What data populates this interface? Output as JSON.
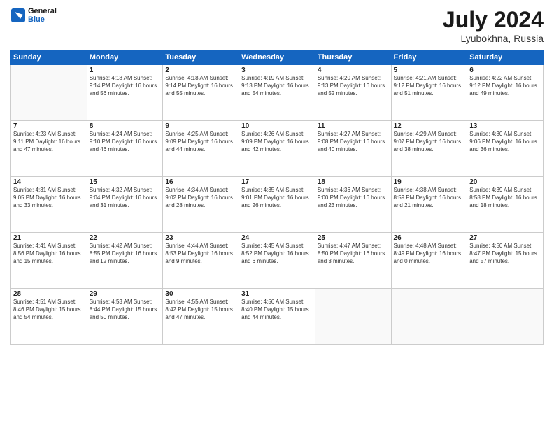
{
  "header": {
    "logo_line1": "General",
    "logo_line2": "Blue",
    "month": "July 2024",
    "location": "Lyubokhna, Russia"
  },
  "columns": [
    "Sunday",
    "Monday",
    "Tuesday",
    "Wednesday",
    "Thursday",
    "Friday",
    "Saturday"
  ],
  "weeks": [
    [
      {
        "day": "",
        "info": ""
      },
      {
        "day": "1",
        "info": "Sunrise: 4:18 AM\nSunset: 9:14 PM\nDaylight: 16 hours\nand 56 minutes."
      },
      {
        "day": "2",
        "info": "Sunrise: 4:18 AM\nSunset: 9:14 PM\nDaylight: 16 hours\nand 55 minutes."
      },
      {
        "day": "3",
        "info": "Sunrise: 4:19 AM\nSunset: 9:13 PM\nDaylight: 16 hours\nand 54 minutes."
      },
      {
        "day": "4",
        "info": "Sunrise: 4:20 AM\nSunset: 9:13 PM\nDaylight: 16 hours\nand 52 minutes."
      },
      {
        "day": "5",
        "info": "Sunrise: 4:21 AM\nSunset: 9:12 PM\nDaylight: 16 hours\nand 51 minutes."
      },
      {
        "day": "6",
        "info": "Sunrise: 4:22 AM\nSunset: 9:12 PM\nDaylight: 16 hours\nand 49 minutes."
      }
    ],
    [
      {
        "day": "7",
        "info": "Sunrise: 4:23 AM\nSunset: 9:11 PM\nDaylight: 16 hours\nand 47 minutes."
      },
      {
        "day": "8",
        "info": "Sunrise: 4:24 AM\nSunset: 9:10 PM\nDaylight: 16 hours\nand 46 minutes."
      },
      {
        "day": "9",
        "info": "Sunrise: 4:25 AM\nSunset: 9:09 PM\nDaylight: 16 hours\nand 44 minutes."
      },
      {
        "day": "10",
        "info": "Sunrise: 4:26 AM\nSunset: 9:09 PM\nDaylight: 16 hours\nand 42 minutes."
      },
      {
        "day": "11",
        "info": "Sunrise: 4:27 AM\nSunset: 9:08 PM\nDaylight: 16 hours\nand 40 minutes."
      },
      {
        "day": "12",
        "info": "Sunrise: 4:29 AM\nSunset: 9:07 PM\nDaylight: 16 hours\nand 38 minutes."
      },
      {
        "day": "13",
        "info": "Sunrise: 4:30 AM\nSunset: 9:06 PM\nDaylight: 16 hours\nand 36 minutes."
      }
    ],
    [
      {
        "day": "14",
        "info": "Sunrise: 4:31 AM\nSunset: 9:05 PM\nDaylight: 16 hours\nand 33 minutes."
      },
      {
        "day": "15",
        "info": "Sunrise: 4:32 AM\nSunset: 9:04 PM\nDaylight: 16 hours\nand 31 minutes."
      },
      {
        "day": "16",
        "info": "Sunrise: 4:34 AM\nSunset: 9:02 PM\nDaylight: 16 hours\nand 28 minutes."
      },
      {
        "day": "17",
        "info": "Sunrise: 4:35 AM\nSunset: 9:01 PM\nDaylight: 16 hours\nand 26 minutes."
      },
      {
        "day": "18",
        "info": "Sunrise: 4:36 AM\nSunset: 9:00 PM\nDaylight: 16 hours\nand 23 minutes."
      },
      {
        "day": "19",
        "info": "Sunrise: 4:38 AM\nSunset: 8:59 PM\nDaylight: 16 hours\nand 21 minutes."
      },
      {
        "day": "20",
        "info": "Sunrise: 4:39 AM\nSunset: 8:58 PM\nDaylight: 16 hours\nand 18 minutes."
      }
    ],
    [
      {
        "day": "21",
        "info": "Sunrise: 4:41 AM\nSunset: 8:56 PM\nDaylight: 16 hours\nand 15 minutes."
      },
      {
        "day": "22",
        "info": "Sunrise: 4:42 AM\nSunset: 8:55 PM\nDaylight: 16 hours\nand 12 minutes."
      },
      {
        "day": "23",
        "info": "Sunrise: 4:44 AM\nSunset: 8:53 PM\nDaylight: 16 hours\nand 9 minutes."
      },
      {
        "day": "24",
        "info": "Sunrise: 4:45 AM\nSunset: 8:52 PM\nDaylight: 16 hours\nand 6 minutes."
      },
      {
        "day": "25",
        "info": "Sunrise: 4:47 AM\nSunset: 8:50 PM\nDaylight: 16 hours\nand 3 minutes."
      },
      {
        "day": "26",
        "info": "Sunrise: 4:48 AM\nSunset: 8:49 PM\nDaylight: 16 hours\nand 0 minutes."
      },
      {
        "day": "27",
        "info": "Sunrise: 4:50 AM\nSunset: 8:47 PM\nDaylight: 15 hours\nand 57 minutes."
      }
    ],
    [
      {
        "day": "28",
        "info": "Sunrise: 4:51 AM\nSunset: 8:46 PM\nDaylight: 15 hours\nand 54 minutes."
      },
      {
        "day": "29",
        "info": "Sunrise: 4:53 AM\nSunset: 8:44 PM\nDaylight: 15 hours\nand 50 minutes."
      },
      {
        "day": "30",
        "info": "Sunrise: 4:55 AM\nSunset: 8:42 PM\nDaylight: 15 hours\nand 47 minutes."
      },
      {
        "day": "31",
        "info": "Sunrise: 4:56 AM\nSunset: 8:40 PM\nDaylight: 15 hours\nand 44 minutes."
      },
      {
        "day": "",
        "info": ""
      },
      {
        "day": "",
        "info": ""
      },
      {
        "day": "",
        "info": ""
      }
    ]
  ]
}
